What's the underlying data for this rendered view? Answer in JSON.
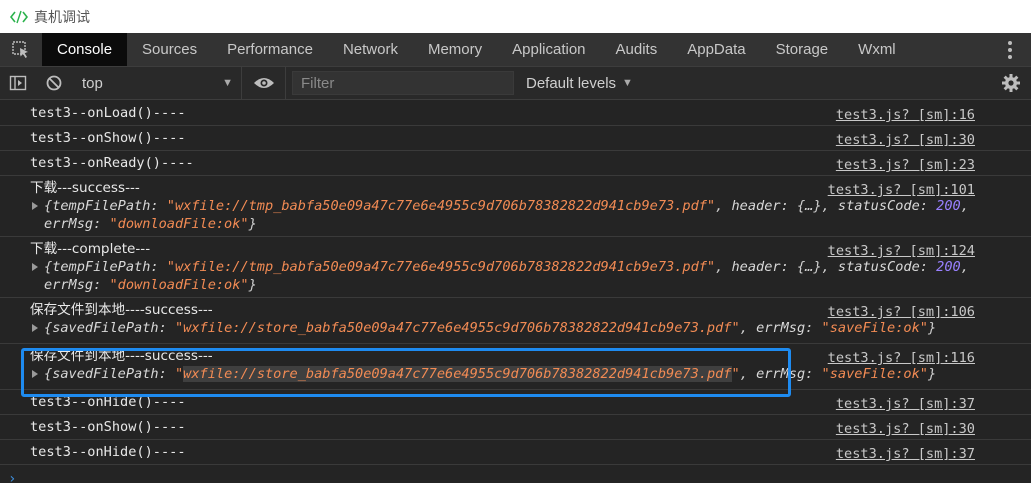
{
  "window": {
    "title": "真机调试",
    "icon": "code-brackets-icon"
  },
  "tabs": [
    {
      "label": "Console",
      "active": true
    },
    {
      "label": "Sources"
    },
    {
      "label": "Performance"
    },
    {
      "label": "Network"
    },
    {
      "label": "Memory"
    },
    {
      "label": "Application"
    },
    {
      "label": "Audits"
    },
    {
      "label": "AppData"
    },
    {
      "label": "Storage"
    },
    {
      "label": "Wxml"
    }
  ],
  "toolbar": {
    "context": "top",
    "filter_placeholder": "Filter",
    "levels": "Default levels"
  },
  "logs": [
    {
      "msg": "test3--onLoad()----",
      "src": "test3.js? [sm]:16"
    },
    {
      "msg": "test3--onShow()----",
      "src": "test3.js? [sm]:30"
    },
    {
      "msg": "test3--onReady()----",
      "src": "test3.js? [sm]:23"
    },
    {
      "msg": "下载---success---",
      "src": "test3.js? [sm]:101",
      "obj": {
        "k1": "tempFilePath",
        "v1": "\"wxfile://tmp_babfa50e09a47c77e6e4955c9d706b78382822d941cb9e73.pdf\"",
        "k2": "header",
        "v2": "{…}",
        "k3": "statusCode",
        "v3": "200",
        "k4": "errMsg",
        "v4": "\"downloadFile:ok\""
      }
    },
    {
      "msg": "下载---complete---",
      "src": "test3.js? [sm]:124",
      "obj": {
        "k1": "tempFilePath",
        "v1": "\"wxfile://tmp_babfa50e09a47c77e6e4955c9d706b78382822d941cb9e73.pdf\"",
        "k2": "header",
        "v2": "{…}",
        "k3": "statusCode",
        "v3": "200",
        "k4": "errMsg",
        "v4": "\"downloadFile:ok\""
      }
    },
    {
      "msg": "保存文件到本地----success---",
      "src": "test3.js? [sm]:106",
      "obj": {
        "k1": "savedFilePath",
        "v1": "\"wxfile://store_babfa50e09a47c77e6e4955c9d706b78382822d941cb9e73.pdf\"",
        "k2": "errMsg",
        "v2": "\"saveFile:ok\""
      }
    },
    {
      "msg": "保存文件到本地----success---",
      "src": "test3.js? [sm]:116",
      "obj": {
        "k1": "savedFilePath",
        "v1_q": "\"",
        "v1": "wxfile://store_babfa50e09a47c77e6e4955c9d706b78382822d941cb9e73.pdf",
        "v1_q2": "\"",
        "k2": "errMsg",
        "v2": "\"saveFile:ok\""
      }
    },
    {
      "msg": "test3--onHide()----",
      "src": "test3.js? [sm]:37"
    },
    {
      "msg": "test3--onShow()----",
      "src": "test3.js? [sm]:30"
    },
    {
      "msg": "test3--onHide()----",
      "src": "test3.js? [sm]:37"
    }
  ],
  "colors": {
    "accent": "#1e8bf0",
    "string": "#f28b54",
    "number": "#9980ff"
  }
}
